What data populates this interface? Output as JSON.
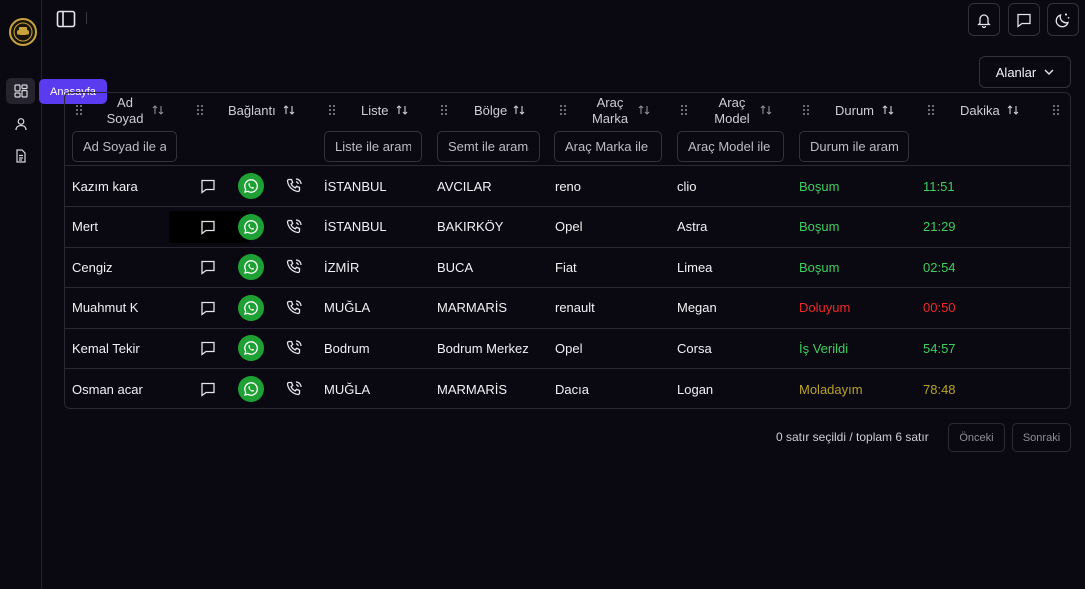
{
  "sidebar": {
    "tooltip": "Anasayfa"
  },
  "toolbar": {
    "fields_button": "Alanlar"
  },
  "table": {
    "columns": {
      "ad_soyad": "Ad Soyad",
      "baglanti": "Bağlantı",
      "liste": "Liste",
      "bolge": "Bölge",
      "marka": "Araç Marka",
      "model": "Araç Model",
      "durum": "Durum",
      "dakika": "Dakika"
    },
    "filters": {
      "ad_soyad": "Ad Soyad ile arama...",
      "liste": "Liste ile arama...",
      "bolge": "Semt ile arama...",
      "marka": "Araç Marka ile arama...",
      "model": "Araç Model ile arama...",
      "durum": "Durum ile arama..."
    },
    "rows": [
      {
        "name": "Kazım kara",
        "liste": "İSTANBUL",
        "bolge": "AVCILAR",
        "marka": "reno",
        "model": "clio",
        "durum": "Boşum",
        "dakika": "11:51",
        "color": "#3ecf5e"
      },
      {
        "name": "Mert",
        "liste": "İSTANBUL",
        "bolge": "BAKIRKÖY",
        "marka": "Opel",
        "model": "Astra",
        "durum": "Boşum",
        "dakika": "21:29",
        "color": "#3ecf5e"
      },
      {
        "name": "Cengiz",
        "liste": "İZMİR",
        "bolge": "BUCA",
        "marka": "Fiat",
        "model": "Limea",
        "durum": "Boşum",
        "dakika": "02:54",
        "color": "#3ecf5e"
      },
      {
        "name": "Muahmut K",
        "liste": "MUĞLA",
        "bolge": "MARMARİS",
        "marka": "renault",
        "model": "Megan",
        "durum": "Doluyum",
        "dakika": "00:50",
        "color": "#ee2a2a"
      },
      {
        "name": "Kemal Tekir",
        "liste": "Bodrum",
        "bolge": "Bodrum Merkez",
        "marka": "Opel",
        "model": "Corsa",
        "durum": "İş Verildi",
        "dakika": "54:57",
        "color": "#3ecf5e"
      },
      {
        "name": "Osman acar",
        "liste": "MUĞLA",
        "bolge": "MARMARİS",
        "marka": "Dacıa",
        "model": "Logan",
        "durum": "Moladayım",
        "dakika": "78:48",
        "color": "#b8a22a"
      }
    ]
  },
  "footer": {
    "selection": "0 satır seçildi / toplam 6 satır",
    "prev": "Önceki",
    "next": "Sonraki"
  }
}
